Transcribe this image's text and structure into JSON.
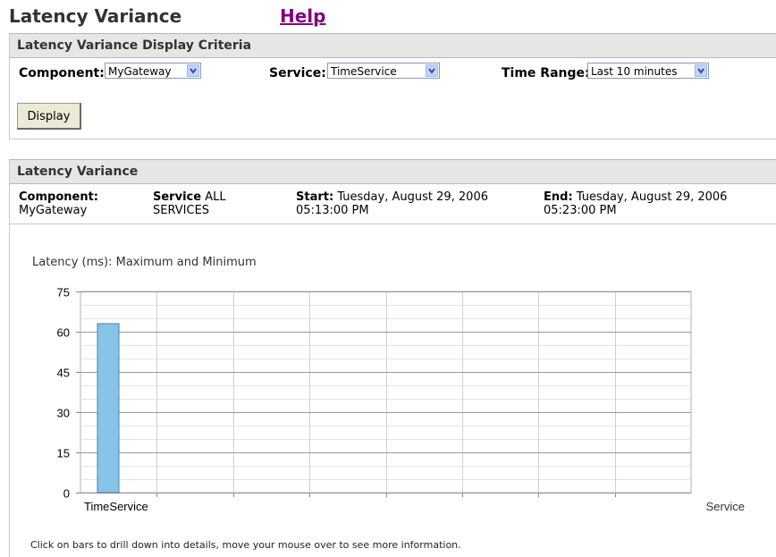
{
  "page": {
    "title": "Latency Variance",
    "help_label": "Help"
  },
  "criteria": {
    "header": "Latency Variance Display Criteria",
    "component_label": "Component:",
    "component_value": "MyGateway",
    "service_label": "Service:",
    "service_value": "TimeService",
    "time_range_label": "Time Range:",
    "time_range_value": "Last 10 minutes",
    "display_button": "Display"
  },
  "variance": {
    "header": "Latency Variance",
    "component_label": "Component:",
    "component_value": "MyGateway",
    "service_label": "Service",
    "service_value_line1": "ALL",
    "service_value_line2": "SERVICES",
    "start_label": "Start:",
    "start_line1": "Tuesday, August 29, 2006",
    "start_line2": "05:13:00 PM",
    "end_label": "End:",
    "end_line1": "Tuesday, August 29, 2006",
    "end_line2": "05:23:00 PM"
  },
  "chart_data": {
    "type": "bar",
    "title": "Latency (ms): Maximum and Minimum",
    "xlabel": "Service",
    "ylabel": "",
    "categories": [
      "TimeService"
    ],
    "values": [
      63
    ],
    "ylim": [
      0,
      75
    ],
    "yticks": [
      0,
      15,
      30,
      45,
      60,
      75
    ],
    "grid": true,
    "bar_color": "#87c5e8"
  },
  "footnote": "Click on bars to drill down into details, move your mouse over to see more information.",
  "colors": {
    "help_link": "#800080",
    "panel_header_bg": "#e6e6e6",
    "button_bg": "#ecead6"
  }
}
